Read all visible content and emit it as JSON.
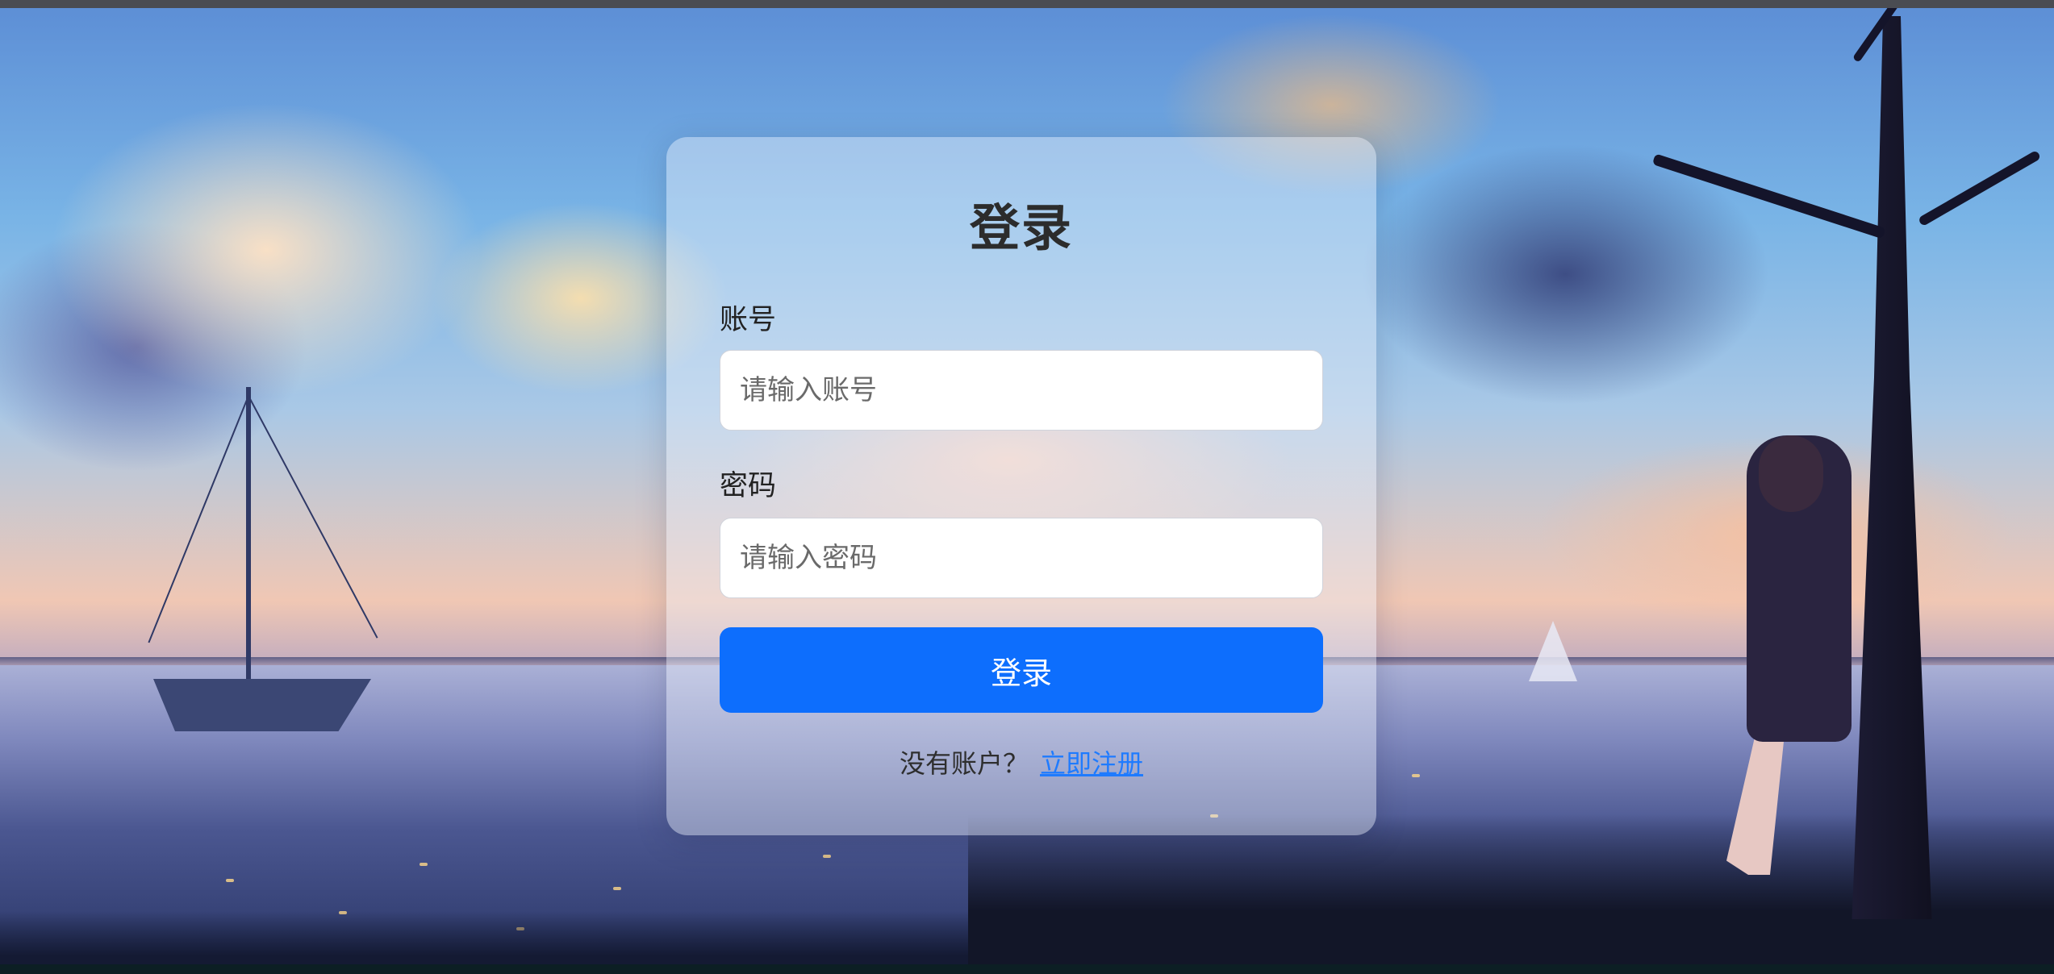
{
  "background": {
    "description_icon": "anime-sunset-lake-icon"
  },
  "login_card": {
    "title": "登录",
    "account": {
      "label": "账号",
      "placeholder": "请输入账号",
      "value": ""
    },
    "password": {
      "label": "密码",
      "placeholder": "请输入密码",
      "value": ""
    },
    "submit_label": "登录",
    "footer": {
      "prompt": "没有账户？",
      "register_link": "立即注册"
    }
  },
  "colors": {
    "primary_button": "#0d6efd",
    "link": "#1f7bff",
    "card_background": "rgba(235,240,250,0.42)"
  }
}
